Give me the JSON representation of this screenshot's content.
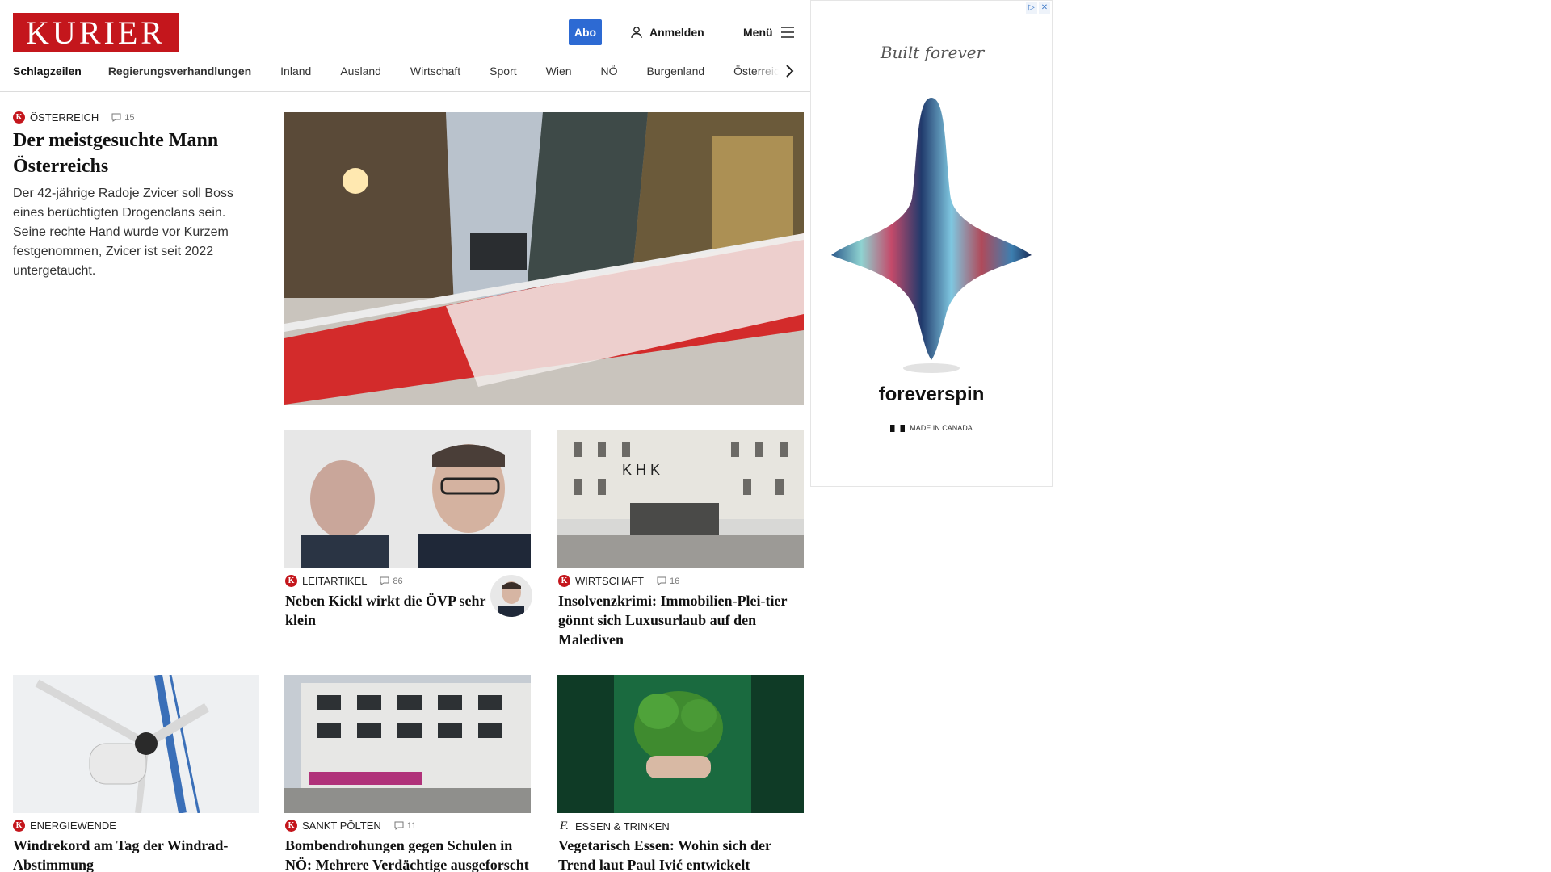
{
  "header": {
    "logo": "KURIER",
    "abo": "Abo",
    "login": "Anmelden",
    "menu": "Menü"
  },
  "nav": {
    "items": [
      "Schlagzeilen",
      "Regierungsverhandlungen",
      "Inland",
      "Ausland",
      "Wirtschaft",
      "Sport",
      "Wien",
      "NÖ",
      "Burgenland",
      "Österreich"
    ]
  },
  "lead_article": {
    "category": "Österreich",
    "comments": "15",
    "title": "Der meistgesuchte Mann Österreichs",
    "teaser": "Der 42-jährige Radoje Zvicer soll Boss eines berüchtigten Drogenclans sein. Seine rechte Hand wurde vor Kurzem festgenommen, Zvicer ist seit 2022 untergetaucht."
  },
  "articles": [
    {
      "category": "Leitartikel",
      "comments": "86",
      "title": "Neben Kickl wirkt die ÖVP sehr klein"
    },
    {
      "category": "Wirtschaft",
      "comments": "16",
      "title": "Insolvenzkrimi: Immobilien-Plei-tier gönnt sich Luxusurlaub auf den Malediven"
    },
    {
      "category": "Energiewende",
      "comments": "",
      "title": "Windrekord am Tag der Windrad-Abstimmung"
    },
    {
      "category": "Sankt Pölten",
      "comments": "11",
      "title": "Bombendrohungen gegen Schulen in NÖ: Mehrere Verdächtige ausgeforscht"
    },
    {
      "category": "Essen & Trinken",
      "comments": "",
      "title": "Vegetarisch Essen: Wohin sich der Trend laut Paul Ivić entwickelt"
    }
  ],
  "ad": {
    "script": "Built forever",
    "brand": "foreverspin",
    "made_in": "MADE IN CANADA"
  },
  "colors": {
    "brand_red": "#c4161c",
    "abo_blue": "#2d6ad3"
  }
}
